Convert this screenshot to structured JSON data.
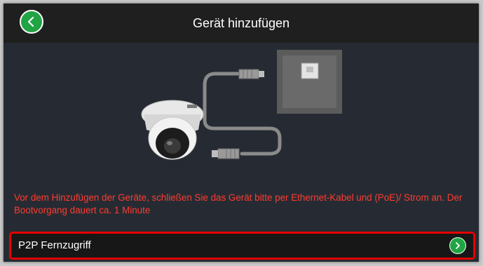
{
  "header": {
    "title": "Gerät hinzufügen",
    "back_icon": "chevron-left-icon"
  },
  "illustration": {
    "camera_icon": "dome-camera-icon",
    "port_icon": "ethernet-port-icon",
    "cable_icon": "ethernet-cable-icon"
  },
  "notice": {
    "text": "Vor dem Hinzufügen der Geräte, schließen Sie das Gerät bitte per Ethernet-Kabel und (PoE)/ Strom an. Der Bootvorgang dauert ca. 1 Minute"
  },
  "options": [
    {
      "label": "P2P Fernzugriff",
      "icon": "chevron-right-icon"
    }
  ],
  "colors": {
    "background": "#262b33",
    "header": "#1f1f1f",
    "accent_green": "#21a443",
    "notice_red": "#ff3b30",
    "highlight_red": "#e60000"
  }
}
